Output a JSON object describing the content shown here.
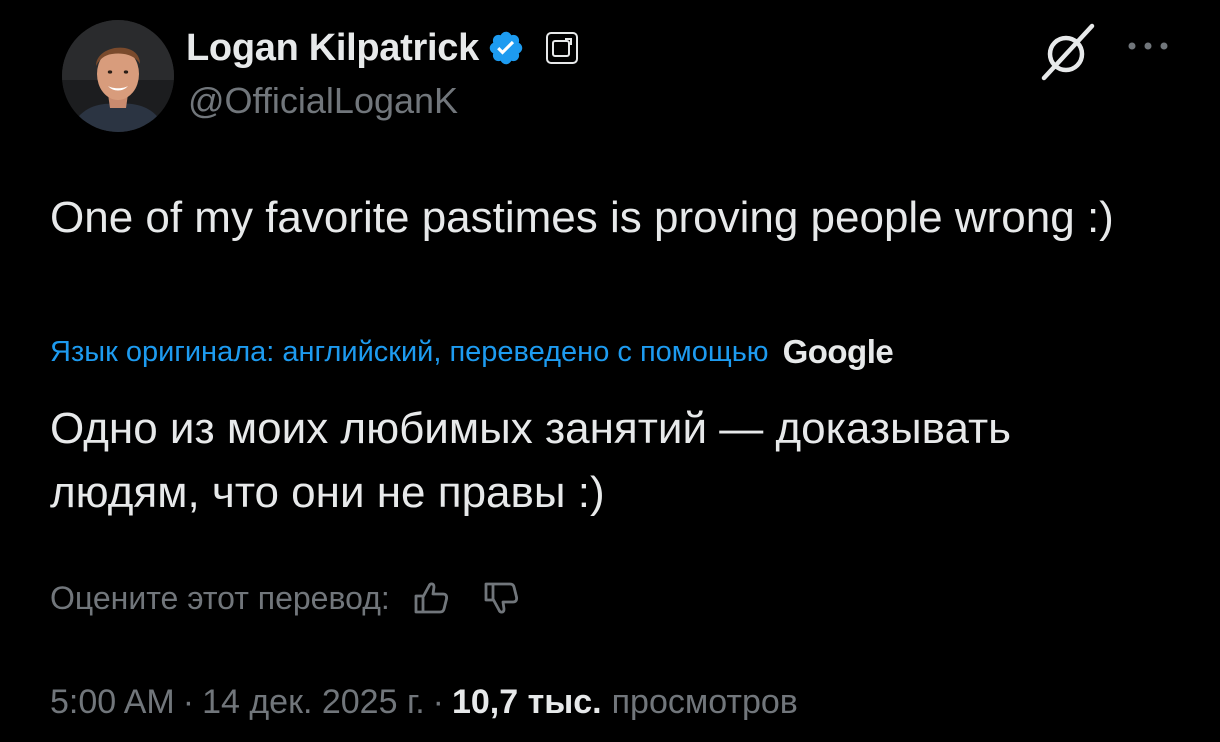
{
  "author": {
    "name": "Logan Kilpatrick",
    "handle": "@OfficialLoganK",
    "verified": true
  },
  "tweet": {
    "text": "One of my favorite pastimes is proving people wrong :)"
  },
  "translation": {
    "note": "Язык оригинала: английский, переведено с помощью",
    "provider": "Google",
    "text": "Одно из моих любимых занятий — доказывать людям, что они не правы :)"
  },
  "rating": {
    "label": "Оцените этот перевод:"
  },
  "meta": {
    "time": "5:00 AM",
    "separator": "·",
    "date": "14 дек. 2025 г.",
    "views_count": "10,7 тыс.",
    "views_label": "просмотров"
  },
  "colors": {
    "background": "#000000",
    "primary_text": "#e7e9ea",
    "secondary_text": "#71767b",
    "link": "#1d9bf0",
    "verified_badge": "#1d9bf0"
  },
  "icons": [
    "verified-badge-icon",
    "affiliate-badge-icon",
    "grok-icon",
    "more-icon",
    "thumbs-up-icon",
    "thumbs-down-icon"
  ]
}
